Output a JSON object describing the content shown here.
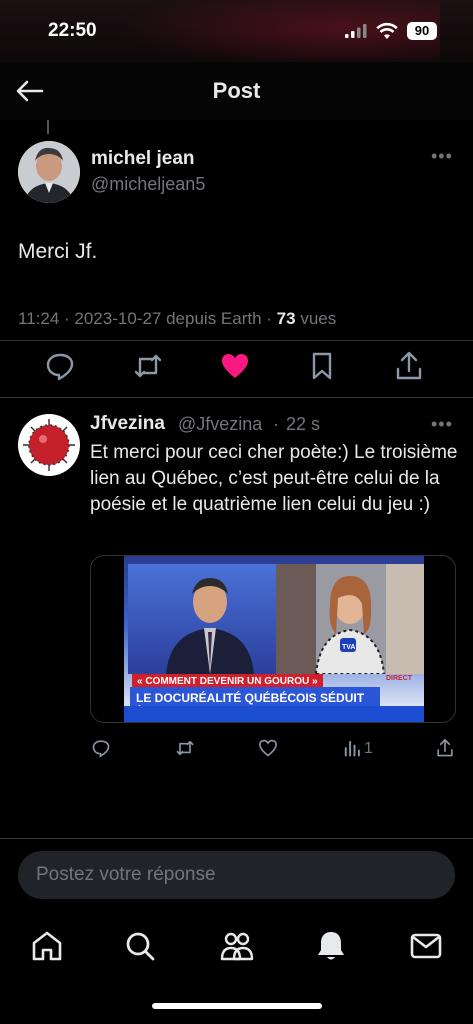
{
  "status_bar": {
    "time": "22:50",
    "battery": "90"
  },
  "header": {
    "title": "Post"
  },
  "main_post": {
    "author_name": "michel jean",
    "author_handle": "@micheljean5",
    "text": "Merci Jf.",
    "time": "11:24",
    "date": "2023-10-27",
    "source": "depuis Earth",
    "views_count": "73",
    "views_label": "vues"
  },
  "reply": {
    "author_name": "Jfvezina",
    "author_handle": "@Jfvezina",
    "age": "22 s",
    "text": "Et merci pour ceci cher poète:) Le troisième lien au Québec, c’est peut-être celui de la poésie et le quatrième lien celui du jeu :)",
    "video": {
      "tag_top": "« COMMENT DEVENIR UN GOUROU »",
      "tag_main": "LE DOCURÉALITÉ QUÉBÉCOIS SÉDUIT À CANNES",
      "live": "DIRECT",
      "mic_label": "TVA"
    },
    "views": "1"
  },
  "composer": {
    "placeholder": "Postez votre réponse"
  },
  "colors": {
    "like": "#f91880",
    "muted": "#71767b",
    "text": "#e7e9ea"
  },
  "icons": {
    "header": "back-arrow-icon",
    "actions": [
      "reply-icon",
      "retweet-icon",
      "heart-filled-icon",
      "bookmark-icon",
      "share-icon"
    ],
    "tabs": [
      "home-icon",
      "search-icon",
      "communities-icon",
      "notifications-icon",
      "messages-icon"
    ]
  }
}
